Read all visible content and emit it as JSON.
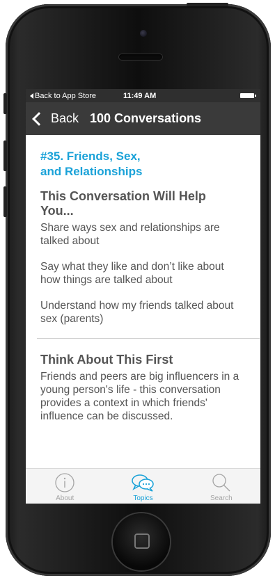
{
  "status_bar": {
    "back_to_app": "Back to App Store",
    "time": "11:49 AM"
  },
  "nav": {
    "back_label": "Back",
    "title": "100 Conversations"
  },
  "topic": {
    "title_line1": "#35. Friends, Sex,",
    "title_line2": "and Relationships"
  },
  "help": {
    "heading_line1": "This Conversation Will Help",
    "heading_line2": "You...",
    "items": [
      "Share ways sex and relationships are talked about",
      "Say what they like and don’t like about how things are talked about",
      "Understand how my friends talked about sex (parents)"
    ]
  },
  "think": {
    "heading": "Think About This First",
    "body": " Friends and peers are big influencers in a young person's life - this conversation provides a context in which friends' influence can be discussed."
  },
  "tabs": [
    {
      "label": "About",
      "icon": "info-icon",
      "active": false
    },
    {
      "label": "Topics",
      "icon": "chat-bubbles-icon",
      "active": true
    },
    {
      "label": "Search",
      "icon": "search-icon",
      "active": false
    }
  ],
  "colors": {
    "accent": "#1aa2d8",
    "nav_bg": "#3a3a3a",
    "status_bg": "#2f2f2f",
    "text": "#555555"
  }
}
